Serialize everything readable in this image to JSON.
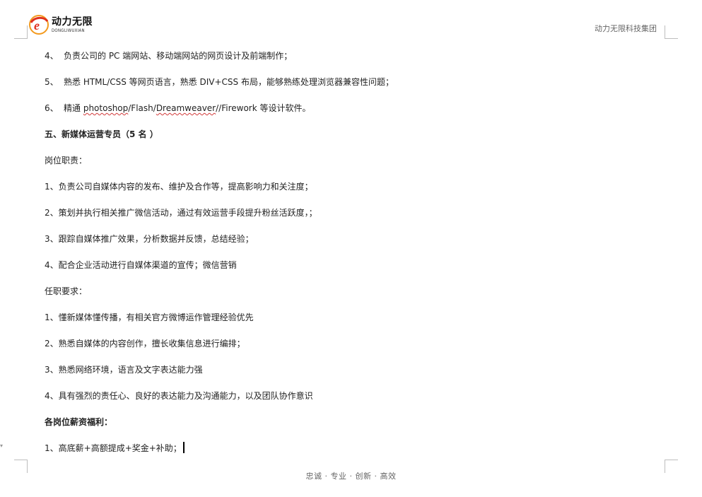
{
  "header": {
    "logo_cn": "动力无限",
    "logo_en": "DONGLIWUXIAN",
    "logo_letter": "e",
    "company": "动力无限科技集团"
  },
  "lines": {
    "l4_num": "4、",
    "l4_text": "负责公司的 PC 端网站、移动端网站的网页设计及前端制作；",
    "l5_num": "5、",
    "l5_text": "熟悉 HTML/CSS 等网页语言，熟悉 DIV+CSS 布局，能够熟练处理浏览器兼容性问题；",
    "l6_num": "6、",
    "l6_pre": "精通 ",
    "l6_ps": "photoshop",
    "l6_mid": "/Flash/",
    "l6_dw": "Dreamweaver",
    "l6_post": "//Firework 等设计软件。",
    "section5": "五、新媒体运营专员（5 名 ）",
    "duty_heading": "岗位职责：",
    "duty1": "1、负责公司自媒体内容的发布、维护及合作等，提高影响力和关注度；",
    "duty2": "2、策划并执行相关推广微信活动，通过有效运营手段提升粉丝活跃度，；",
    "duty3": "3、跟踪自媒体推广效果，分析数据并反馈，总结经验；",
    "duty4": "4、配合企业活动进行自媒体渠道的宣传；微信营销",
    "req_heading": "任职要求：",
    "req1": "1、懂新媒体懂传播，有相关官方微博运作管理经验优先",
    "req2": "2、熟悉自媒体的内容创作，擅长收集信息进行编排；",
    "req3": "3、熟悉网络环境，语言及文字表达能力强",
    "req4": "4、具有强烈的责任心、良好的表达能力及沟通能力，以及团队协作意识",
    "benefits_heading": "各岗位薪资福利：",
    "benefit1": "1、高底薪+高额提成+奖金+补助；"
  },
  "footer": "忠诚 · 专业 · 创新 · 高效",
  "colors": {
    "logo_red": "#e0301e",
    "logo_orange": "#f39a1e",
    "spellcheck": "#d23a3a"
  }
}
